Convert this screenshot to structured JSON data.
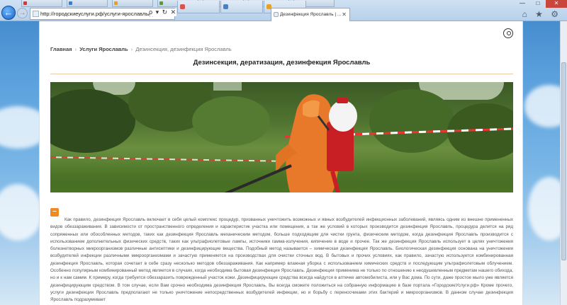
{
  "browser": {
    "url": "http://городскиеуслуги.рф/услуги-ярославль/дезинск",
    "address_icons": "ρ ▾ ↻ ✕",
    "active_tab": "Дезинфекция Ярославль | ...",
    "active_tab_close": "✕",
    "tabs": [
      {
        "label": "",
        "color": "#d9534f"
      },
      {
        "label": "",
        "color": "#4a7fc1"
      },
      {
        "label": "",
        "color": "#e5a227"
      }
    ],
    "upper_tabs": [
      {
        "label": "",
        "color": "#cf3b3b"
      },
      {
        "label": "",
        "color": "#3c7fc9"
      },
      {
        "label": "",
        "color": "#e2a12c"
      },
      {
        "label": "",
        "color": "#5a9a3a"
      },
      {
        "label": "",
        "color": "#3a7bbf"
      },
      {
        "label": "",
        "color": "#8a6ab3"
      },
      {
        "label": "",
        "color": "#2f8ad8"
      }
    ],
    "window_controls": [
      "—",
      "□",
      "✕"
    ],
    "toolbar_icons": "⌂ ★ ⚙"
  },
  "page": {
    "breadcrumb": {
      "home": "Главная",
      "section": "Услуги Ярославль",
      "current": "Дезинсекция, дезинфекция Ярославль",
      "separator": "›"
    },
    "title": "Дезинсекция, дератизация, дезинфекция Ярославль",
    "toggle_label": "–",
    "body": "Как правило, дезинфекция Ярославль включает в себя целый комплекс процедур, призванных уничтожить возможных и явных возбудителей инфекционных заболеваний, являясь одним из внешне примененных видов обеззараживания. В зависимости от пространственного определения и характеристик участка или помещения, а так же условий в которых производится дезинфекция Ярославль, процедура делится на ряд сопряженных или обособленных методов, таких как дезинфекция Ярославль механическим методом, больше подходящим для чистки грунта, физическим методом, когда дезинфекция Ярославль производится с использованием дополнительных физических средств, таких как ультрафиолетовые лампы, источники гамма-излучения, кипячение в воде и прочее. Так же дезинфекция Ярославль использует в целях уничтожения болезнетворных микроорганизмов различные антисептики и дезинфицирующие вещества. Подобный метод называется – химическая дезинфекция Ярославль. Биологическая дезинфекция основана на уничтожении возбудителей инфекции различными микроорганизмами и зачастую применяется на производствах для очистки сточных вод. В бытовых и прочих условиях, как правило, зачастую используется комбинированная дезинфекция Ярославль, которая сочетает в себе сразу несколько методов обеззараживания. Как например влажная уборка с использованием химических средств и последующим ультрафиолетовым облучением. Особенно популярным комбинированный метод является в случаях, когда необходима бытовая дезинфекция Ярославль. Дезинфекция применима не только по отношению к неодушевленным предметам нашего обихода, но и к нам самим. К примеру, когда требуется обеззаразить поврежденный участок кожи. Дезинфицирующие средства всегда найдутся в аптечке автомобилиста, или у Вас дома. По сути, даже простое мыло уже является дезинфицирующим средством. В том случае, если Вам срочно необходима дезинфекция Ярославль, Вы всегда сможете положиться на собранную информацию в базе портала «ГородскиеУслуги.рф» Кроме прочего, услуги дезинфекции Ярославль предполагают не только уничтожение непосредственных возбудителей инфекции, но и борьбу с переносчиками этих бактерий и микроорганизмов. В данном случае дезинфекция Ярославль подразумевает"
  },
  "colors": {
    "accent": "#f18a21",
    "rule": "#e8c9a8"
  }
}
